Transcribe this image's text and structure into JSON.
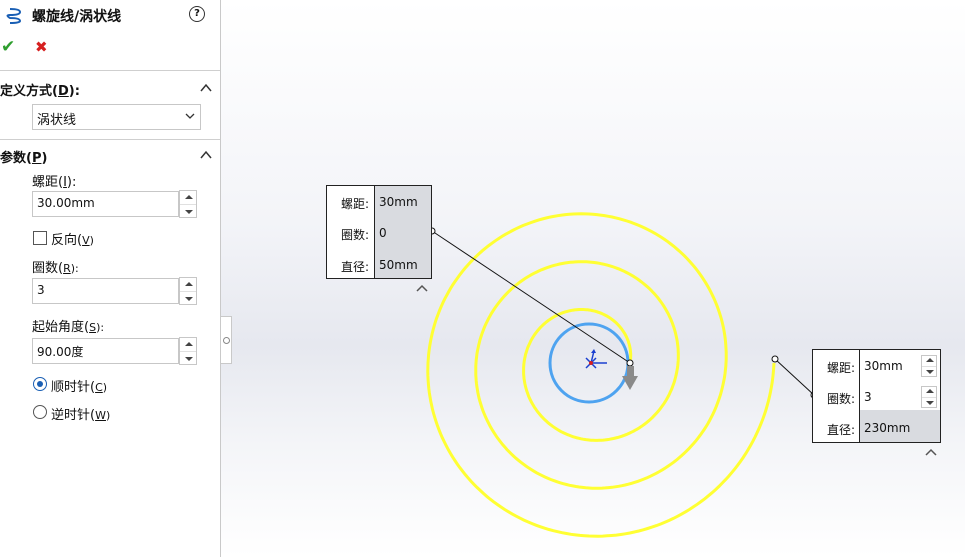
{
  "panel": {
    "title": "螺旋线/涡状线",
    "help_icon": "?",
    "ok_icon": "✔",
    "cancel_icon": "✖",
    "definition": {
      "header": "定义方式(D):",
      "header_text": "定义方式(",
      "header_key": "D",
      "header_tail": "):",
      "selected": "涡状线"
    },
    "params": {
      "header_text": "参数(",
      "header_key": "P",
      "header_tail": ")",
      "pitch_label": "螺距(",
      "pitch_key": "I",
      "pitch_tail": "):",
      "pitch_value": "30.00mm",
      "reverse_label": "反向(",
      "reverse_key": "V",
      "reverse_tail": ")",
      "reverse_checked": false,
      "revolutions_label": "圈数(",
      "revolutions_key": "R",
      "revolutions_tail": "):",
      "revolutions_value": "3",
      "start_angle_label": "起始角度(",
      "start_angle_key": "S",
      "start_angle_tail": "):",
      "start_angle_value": "90.00度",
      "clockwise_label": "顺时针(",
      "clockwise_key": "C",
      "clockwise_tail": ")",
      "counter_label": "逆时针(",
      "counter_key": "W",
      "counter_tail": ")",
      "direction": "clockwise"
    }
  },
  "callout_start": {
    "pitch_label": "螺距:",
    "pitch_value": "30mm",
    "revs_label": "圈数:",
    "revs_value": "0",
    "diameter_label": "直径:",
    "diameter_value": "50mm"
  },
  "callout_end": {
    "pitch_label": "螺距:",
    "pitch_value": "30mm",
    "revs_label": "圈数:",
    "revs_value": "3",
    "diameter_label": "直径:",
    "diameter_value": "230mm"
  },
  "colors": {
    "spiral": "#ffff33",
    "circle": "#4ea3f0",
    "ok": "#2e9e2e",
    "cancel": "#d62020",
    "accent": "#1a5fb4"
  }
}
